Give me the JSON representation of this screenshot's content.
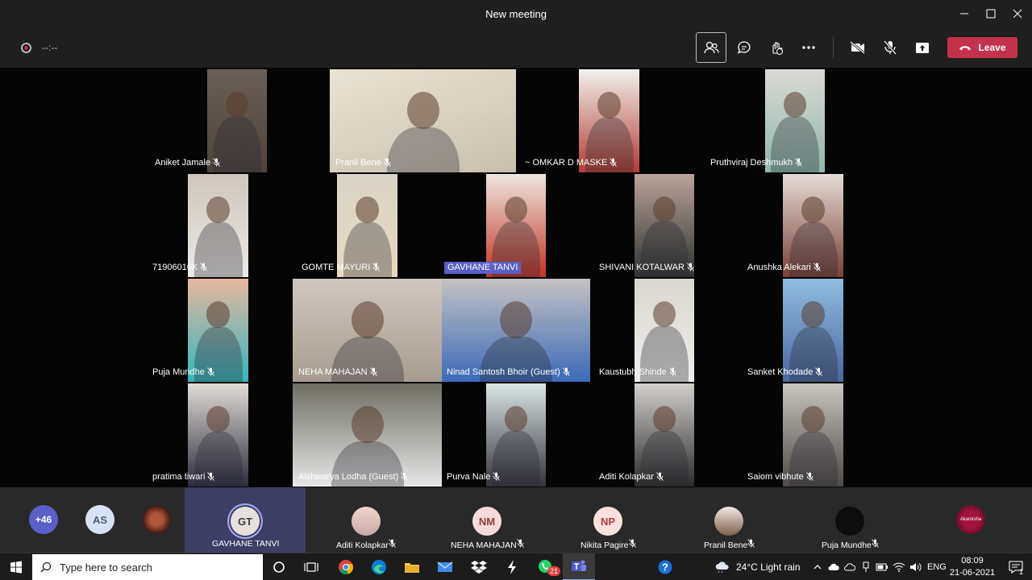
{
  "window": {
    "title": "New meeting"
  },
  "toolbar": {
    "timer": "--:--",
    "leave_label": "Leave"
  },
  "grid": [
    {
      "name": "Aniket Jamale",
      "muted": true
    },
    {
      "name": "Pranil Bene",
      "muted": true
    },
    {
      "name": "~ OMKAR D MASKE",
      "muted": true
    },
    {
      "name": "Pruthviraj Deshmukh",
      "muted": true
    },
    {
      "name": "71906010K",
      "muted": true
    },
    {
      "name": "GOMTE MAYURI",
      "muted": true
    },
    {
      "name": "GAVHANE TANVI",
      "muted": false,
      "highlight": true
    },
    {
      "name": "SHIVANI KOTALWAR",
      "muted": true
    },
    {
      "name": "Anushka Alekari",
      "muted": true
    },
    {
      "name": "Puja Mundhe",
      "muted": true
    },
    {
      "name": "NEHA MAHAJAN",
      "muted": true
    },
    {
      "name": "Ninad Santosh Bhoir (Guest)",
      "muted": true
    },
    {
      "name": "Kaustubh Shinde",
      "muted": true
    },
    {
      "name": "Sanket Khodade",
      "muted": true
    },
    {
      "name": "pratima tiwari",
      "muted": true
    },
    {
      "name": "Aishwarya Lodha (Guest)",
      "muted": true
    },
    {
      "name": "Purva Nale",
      "muted": true
    },
    {
      "name": "Aditi Kolapkar",
      "muted": true
    },
    {
      "name": "Saiom vibhute",
      "muted": true
    }
  ],
  "roster": {
    "overflow": {
      "count": "+46",
      "color": "#5b5fc7"
    },
    "initials_chip": "AS",
    "tiles": [
      {
        "name": "GAVHANE TANVI",
        "initials": "GT",
        "selected": true,
        "muted": false
      },
      {
        "name": "Aditi Kolapkar",
        "initials": "",
        "selected": false,
        "muted": true
      },
      {
        "name": "NEHA MAHAJAN",
        "initials": "NM",
        "selected": false,
        "muted": true
      },
      {
        "name": "Nikita Pagire",
        "initials": "NP",
        "selected": false,
        "muted": true
      },
      {
        "name": "Pranil Bene",
        "initials": "",
        "selected": false,
        "muted": true
      },
      {
        "name": "Puja Mundhe",
        "initials": "",
        "selected": false,
        "muted": true
      }
    ],
    "last_avatar_text": "Akanksha"
  },
  "taskbar": {
    "search_placeholder": "Type here to search",
    "whatsapp_badge": "21",
    "weather": "24°C  Light rain",
    "language": "ENG",
    "time": "08:09",
    "date": "21-06-2021",
    "notification_count": "1"
  },
  "colors": {
    "accent": "#5b5fc7",
    "leave": "#c4314b",
    "chrome": "#1f1f1f"
  }
}
